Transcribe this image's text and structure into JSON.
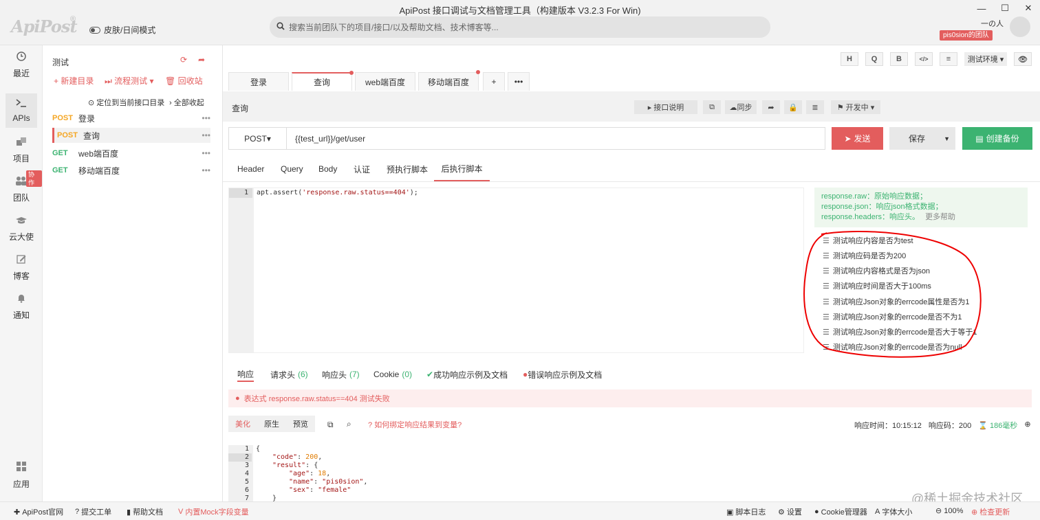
{
  "window": {
    "title": "ApiPost 接口调试与文档管理工具（构建版本 V3.2.3 For Win)",
    "controls": [
      "—",
      "☐",
      "✕"
    ]
  },
  "app": {
    "logo": "ApiPost",
    "logo_reg": "®",
    "skin_mode": "皮肤/日间模式",
    "search_placeholder": "搜索当前团队下的项目/接口/以及帮助文档、技术博客等...",
    "username": "一の人",
    "team": "pis0sion的团队"
  },
  "leftnav": [
    {
      "label": "最近",
      "icon": "clock-icon"
    },
    {
      "label": "APIs",
      "icon": "terminal-icon"
    },
    {
      "label": "项目",
      "icon": "project-icon"
    },
    {
      "label": "团队",
      "icon": "team-icon",
      "badge": "协作"
    },
    {
      "label": "云大使",
      "icon": "graduation-icon"
    },
    {
      "label": "博客",
      "icon": "edit-icon"
    },
    {
      "label": "通知",
      "icon": "bell-icon"
    },
    {
      "label": "应用",
      "icon": "apps-icon"
    }
  ],
  "tree": {
    "title": "测试",
    "new_dir": "+ 新建目录",
    "flow_test": "流程测试",
    "recycle": "回收站",
    "locate": "定位到当前接口目录",
    "collapse_all": "全部收起",
    "items": [
      {
        "method": "POST",
        "name": "登录"
      },
      {
        "method": "POST",
        "name": "查询"
      },
      {
        "method": "GET",
        "name": "web端百度"
      },
      {
        "method": "GET",
        "name": "移动端百度"
      }
    ]
  },
  "toolbar": {
    "buttons": [
      "H",
      "Q",
      "B",
      "</>",
      "≡"
    ],
    "env": "测试环境"
  },
  "tabs": [
    "登录",
    "查询",
    "web端百度",
    "移动端百度"
  ],
  "api": {
    "name": "查询",
    "doc_btn": "接口说明",
    "sync_btn": "同步",
    "status_btn": "开发中",
    "method": "POST",
    "url": "{{test_url}}/get/user",
    "send": "发送",
    "save": "保存",
    "backup": "创建备份"
  },
  "req_tabs": [
    "Header",
    "Query",
    "Body",
    "认证",
    "预执行脚本",
    "后执行脚本"
  ],
  "script": {
    "line": "1",
    "prefix": "apt.assert(",
    "str": "'response.raw.status==404'",
    "suffix": ");"
  },
  "help": {
    "lines": [
      "response.raw：原始响应数据；",
      "response.json：响应json格式数据；",
      "response.headers：响应头。"
    ],
    "more": "更多帮助"
  },
  "snippets": [
    "测试响应内容是否为test",
    "测试响应码是否为200",
    "测试响应内容格式是否为json",
    "测试响应时间是否大于100ms",
    "测试响应Json对象的errcode属性是否为1",
    "测试响应Json对象的errcode是否不为1",
    "测试响应Json对象的errcode是否大于等于1",
    "测试响应Json对象的errcode是否为null"
  ],
  "resp_tabs": [
    {
      "label": "响应",
      "count": ""
    },
    {
      "label": "请求头",
      "count": "(6)"
    },
    {
      "label": "响应头",
      "count": "(7)"
    },
    {
      "label": "Cookie",
      "count": "(0)"
    },
    {
      "label": "成功响应示例及文档",
      "count": ""
    },
    {
      "label": "错误响应示例及文档",
      "count": ""
    }
  ],
  "assert_error": "表达式 response.raw.status==404 测试失败",
  "view_modes": [
    "美化",
    "原生",
    "预览"
  ],
  "bind_help": "如何绑定响应结果到变量?",
  "resp_meta": {
    "time": "响应时间：10:15:12",
    "code": "响应码：200",
    "duration": "186毫秒"
  },
  "resp_lines": [
    "1",
    "2",
    "3",
    "4",
    "5",
    "6",
    "7"
  ],
  "resp_json": {
    "code_key": "\"code\"",
    "code_val": "200",
    "result_key": "\"result\"",
    "age_key": "\"age\"",
    "age_val": "18",
    "name_key": "\"name\"",
    "name_val": "\"pis0sion\"",
    "sex_key": "\"sex\"",
    "sex_val": "\"female\""
  },
  "bottom": {
    "left": [
      "ApiPost官网",
      "提交工单",
      "帮助文档",
      "内置Mock字段变量"
    ],
    "right": [
      "脚本日志",
      "设置",
      "Cookie管理器",
      "字体大小",
      "100%",
      "检查更新"
    ]
  },
  "watermark": "@稀土掘金技术社区",
  "colors": {
    "accent": "#e35d5d",
    "green": "#3cb371",
    "post": "#f5a623"
  }
}
